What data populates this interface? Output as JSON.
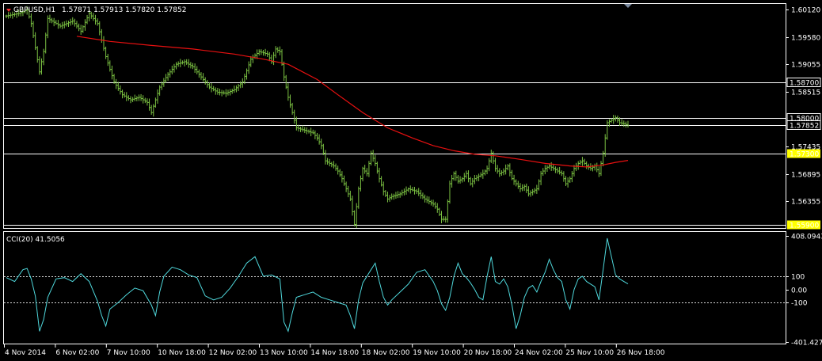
{
  "window": {
    "symbol_label": "GBPUSD,H1",
    "ohlc": "1.57871 1.57913 1.57820 1.57852"
  },
  "indicator": {
    "label": "CCI(20) 41.5056"
  },
  "colors": {
    "background": "#000000",
    "bars": "#7bc142",
    "moving_average": "#e81010",
    "cci_line": "#4fd8dc",
    "highlight_label": "#ffff00",
    "axis": "#ffffff"
  },
  "chart_data": [
    {
      "type": "bar",
      "title": "GBPUSD,H1",
      "ylim": [
        1.5583,
        1.6022
      ],
      "y_ticks": [
        "1.60120",
        "1.59580",
        "1.59055",
        "1.58515",
        "1.57435",
        "1.56895",
        "1.56355"
      ],
      "horizontal_lines": [
        {
          "value": 1.587,
          "label": "1.58700",
          "highlight": false
        },
        {
          "value": 1.58,
          "label": "1.58000",
          "highlight": false
        },
        {
          "value": 1.57852,
          "label": "1.57852",
          "highlight": false
        },
        {
          "value": 1.573,
          "label": "1.57300",
          "highlight": true
        },
        {
          "value": 1.559,
          "label": "1.55900",
          "highlight": true
        }
      ],
      "x_labels": [
        "4 Nov 2014",
        "6 Nov 02:00",
        "7 Nov 10:00",
        "10 Nov 18:00",
        "12 Nov 02:00",
        "13 Nov 10:00",
        "14 Nov 18:00",
        "18 Nov 02:00",
        "19 Nov 10:00",
        "20 Nov 18:00",
        "24 Nov 02:00",
        "25 Nov 10:00",
        "26 Nov 18:00"
      ],
      "series": [
        {
          "kind": "close_path",
          "points": [
            [
              0,
              1.6
            ],
            [
              3,
              1.6005
            ],
            [
              5,
              1.6012
            ],
            [
              6,
              1.5985
            ],
            [
              8,
              1.589
            ],
            [
              9,
              1.593
            ],
            [
              10,
              1.5995
            ],
            [
              13,
              1.598
            ],
            [
              16,
              1.599
            ],
            [
              18,
              1.597
            ],
            [
              20,
              1.6005
            ],
            [
              22,
              1.5985
            ],
            [
              24,
              1.592
            ],
            [
              26,
              1.587
            ],
            [
              28,
              1.5845
            ],
            [
              30,
              1.5835
            ],
            [
              32,
              1.584
            ],
            [
              34,
              1.583
            ],
            [
              35,
              1.581
            ],
            [
              37,
              1.586
            ],
            [
              39,
              1.5885
            ],
            [
              41,
              1.5905
            ],
            [
              43,
              1.591
            ],
            [
              45,
              1.59
            ],
            [
              47,
              1.588
            ],
            [
              49,
              1.586
            ],
            [
              51,
              1.585
            ],
            [
              53,
              1.5848
            ],
            [
              55,
              1.5855
            ],
            [
              57,
              1.587
            ],
            [
              59,
              1.5915
            ],
            [
              61,
              1.593
            ],
            [
              63,
              1.5925
            ],
            [
              64,
              1.591
            ],
            [
              65,
              1.5935
            ],
            [
              66,
              1.593
            ],
            [
              67,
              1.588
            ],
            [
              68,
              1.584
            ],
            [
              69,
              1.581
            ],
            [
              70,
              1.578
            ],
            [
              72,
              1.5775
            ],
            [
              74,
              1.577
            ],
            [
              75,
              1.576
            ],
            [
              76,
              1.5745
            ],
            [
              77,
              1.5715
            ],
            [
              79,
              1.5705
            ],
            [
              80,
              1.5695
            ],
            [
              81,
              1.568
            ],
            [
              82,
              1.566
            ],
            [
              83,
              1.564
            ],
            [
              84,
              1.559
            ],
            [
              85,
              1.566
            ],
            [
              86,
              1.57
            ],
            [
              87,
              1.569
            ],
            [
              88,
              1.573
            ],
            [
              89,
              1.571
            ],
            [
              90,
              1.568
            ],
            [
              91,
              1.5655
            ],
            [
              92,
              1.564
            ],
            [
              93,
              1.5645
            ],
            [
              95,
              1.565
            ],
            [
              97,
              1.566
            ],
            [
              99,
              1.5655
            ],
            [
              101,
              1.564
            ],
            [
              103,
              1.563
            ],
            [
              104,
              1.562
            ],
            [
              105,
              1.56
            ],
            [
              106,
              1.56
            ],
            [
              107,
              1.567
            ],
            [
              108,
              1.569
            ],
            [
              109,
              1.5675
            ],
            [
              110,
              1.568
            ],
            [
              111,
              1.569
            ],
            [
              112,
              1.567
            ],
            [
              113,
              1.568
            ],
            [
              114,
              1.5685
            ],
            [
              115,
              1.569
            ],
            [
              116,
              1.57
            ],
            [
              117,
              1.573
            ],
            [
              118,
              1.57
            ],
            [
              119,
              1.569
            ],
            [
              120,
              1.5695
            ],
            [
              121,
              1.5705
            ],
            [
              122,
              1.568
            ],
            [
              123,
              1.567
            ],
            [
              124,
              1.566
            ],
            [
              125,
              1.5665
            ],
            [
              126,
              1.565
            ],
            [
              127,
              1.5655
            ],
            [
              128,
              1.566
            ],
            [
              129,
              1.569
            ],
            [
              130,
              1.57
            ],
            [
              131,
              1.5705
            ],
            [
              132,
              1.57
            ],
            [
              133,
              1.5695
            ],
            [
              134,
              1.569
            ],
            [
              135,
              1.567
            ],
            [
              136,
              1.568
            ],
            [
              137,
              1.57
            ],
            [
              138,
              1.571
            ],
            [
              139,
              1.5715
            ],
            [
              140,
              1.5705
            ],
            [
              141,
              1.57
            ],
            [
              142,
              1.5705
            ],
            [
              143,
              1.569
            ],
            [
              144,
              1.573
            ],
            [
              145,
              1.579
            ],
            [
              146,
              1.5795
            ],
            [
              147,
              1.58
            ],
            [
              148,
              1.579
            ],
            [
              149,
              1.5788
            ],
            [
              150,
              1.5785
            ]
          ]
        },
        {
          "kind": "moving_average",
          "points": [
            [
              17,
              1.596
            ],
            [
              25,
              1.595
            ],
            [
              35,
              1.5942
            ],
            [
              45,
              1.5935
            ],
            [
              55,
              1.5925
            ],
            [
              62,
              1.5915
            ],
            [
              68,
              1.5905
            ],
            [
              75,
              1.5875
            ],
            [
              80,
              1.5845
            ],
            [
              86,
              1.581
            ],
            [
              92,
              1.578
            ],
            [
              98,
              1.576
            ],
            [
              103,
              1.5745
            ],
            [
              108,
              1.5735
            ],
            [
              113,
              1.5728
            ],
            [
              118,
              1.5725
            ],
            [
              124,
              1.5718
            ],
            [
              130,
              1.571
            ],
            [
              136,
              1.5705
            ],
            [
              140,
              1.5703
            ],
            [
              144,
              1.5707
            ],
            [
              147,
              1.5712
            ],
            [
              150,
              1.5716
            ]
          ]
        }
      ]
    },
    {
      "type": "line",
      "title": "CCI(20) 41.5056",
      "ylim": [
        -401.4278,
        408.0943
      ],
      "y_ticks": [
        "408.0943",
        "100",
        "0.00",
        "-100",
        "-401.4278"
      ],
      "levels": [
        100,
        -100
      ],
      "series": [
        {
          "name": "CCI(20)",
          "points": [
            [
              0,
              90
            ],
            [
              2,
              60
            ],
            [
              4,
              150
            ],
            [
              5,
              160
            ],
            [
              6,
              80
            ],
            [
              7,
              -50
            ],
            [
              8,
              -320
            ],
            [
              9,
              -230
            ],
            [
              10,
              -60
            ],
            [
              12,
              80
            ],
            [
              14,
              90
            ],
            [
              16,
              60
            ],
            [
              18,
              120
            ],
            [
              20,
              60
            ],
            [
              22,
              -90
            ],
            [
              23,
              -200
            ],
            [
              24,
              -280
            ],
            [
              25,
              -150
            ],
            [
              27,
              -100
            ],
            [
              29,
              -40
            ],
            [
              31,
              10
            ],
            [
              33,
              -10
            ],
            [
              35,
              -120
            ],
            [
              36,
              -200
            ],
            [
              37,
              -20
            ],
            [
              38,
              100
            ],
            [
              40,
              170
            ],
            [
              42,
              150
            ],
            [
              44,
              110
            ],
            [
              46,
              90
            ],
            [
              48,
              -50
            ],
            [
              50,
              -80
            ],
            [
              52,
              -60
            ],
            [
              54,
              10
            ],
            [
              56,
              100
            ],
            [
              58,
              200
            ],
            [
              60,
              250
            ],
            [
              62,
              100
            ],
            [
              64,
              110
            ],
            [
              66,
              80
            ],
            [
              67,
              -250
            ],
            [
              68,
              -320
            ],
            [
              69,
              -180
            ],
            [
              70,
              -60
            ],
            [
              72,
              -40
            ],
            [
              74,
              -20
            ],
            [
              76,
              -60
            ],
            [
              78,
              -80
            ],
            [
              80,
              -100
            ],
            [
              82,
              -120
            ],
            [
              83,
              -200
            ],
            [
              84,
              -300
            ],
            [
              85,
              -80
            ],
            [
              86,
              50
            ],
            [
              88,
              150
            ],
            [
              89,
              200
            ],
            [
              90,
              60
            ],
            [
              91,
              -60
            ],
            [
              92,
              -120
            ],
            [
              93,
              -80
            ],
            [
              95,
              -20
            ],
            [
              97,
              40
            ],
            [
              99,
              130
            ],
            [
              101,
              150
            ],
            [
              103,
              60
            ],
            [
              104,
              -10
            ],
            [
              105,
              -110
            ],
            [
              106,
              -160
            ],
            [
              107,
              -60
            ],
            [
              108,
              100
            ],
            [
              109,
              200
            ],
            [
              110,
              120
            ],
            [
              111,
              90
            ],
            [
              112,
              50
            ],
            [
              113,
              0
            ],
            [
              114,
              -60
            ],
            [
              115,
              -80
            ],
            [
              116,
              100
            ],
            [
              117,
              250
            ],
            [
              118,
              60
            ],
            [
              119,
              40
            ],
            [
              120,
              80
            ],
            [
              121,
              20
            ],
            [
              122,
              -120
            ],
            [
              123,
              -300
            ],
            [
              124,
              -200
            ],
            [
              125,
              -60
            ],
            [
              126,
              10
            ],
            [
              127,
              30
            ],
            [
              128,
              -20
            ],
            [
              129,
              60
            ],
            [
              130,
              130
            ],
            [
              131,
              230
            ],
            [
              132,
              150
            ],
            [
              133,
              90
            ],
            [
              134,
              60
            ],
            [
              135,
              -80
            ],
            [
              136,
              -150
            ],
            [
              137,
              0
            ],
            [
              138,
              80
            ],
            [
              139,
              100
            ],
            [
              140,
              60
            ],
            [
              141,
              40
            ],
            [
              142,
              20
            ],
            [
              143,
              -80
            ],
            [
              144,
              150
            ],
            [
              145,
              390
            ],
            [
              146,
              250
            ],
            [
              147,
              110
            ],
            [
              148,
              80
            ],
            [
              149,
              60
            ],
            [
              150,
              42
            ]
          ]
        }
      ]
    }
  ]
}
